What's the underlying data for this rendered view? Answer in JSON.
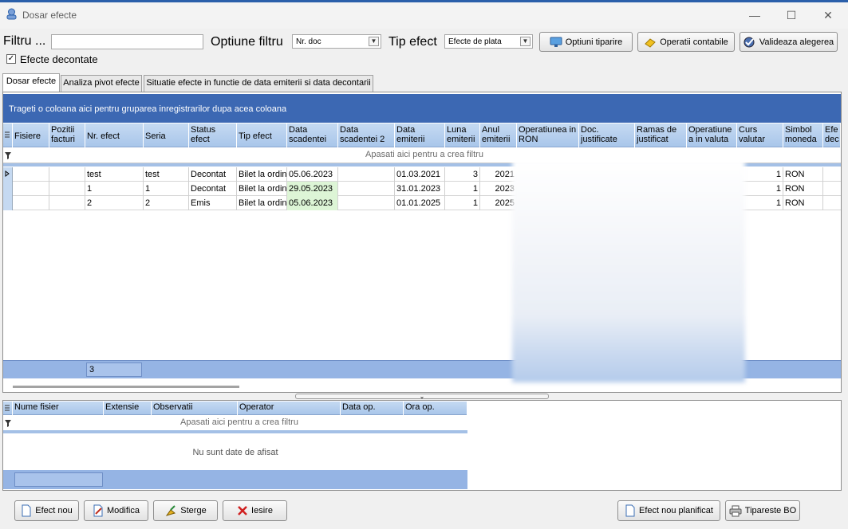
{
  "window": {
    "title": "Dosar efecte",
    "minimize": "—",
    "maximize": "☐",
    "close": "✕"
  },
  "toolbar": {
    "filter_label": "Filtru ...",
    "filter_value": "",
    "filter_option_label": "Optiune filtru",
    "filter_option_value": "Nr. doc",
    "effect_type_label": "Tip efect",
    "effect_type_value": "Efecte de plata",
    "print_options": "Optiuni tiparire",
    "accounting_ops": "Operatii contabile",
    "validate": "Valideaza alegerea",
    "settled_label": "Efecte decontate",
    "settled_checked": true
  },
  "tabs": [
    {
      "label": "Dosar efecte",
      "active": true
    },
    {
      "label": "Analiza pivot efecte",
      "active": false
    },
    {
      "label": "Situatie efecte in functie de data emiterii si data decontarii",
      "active": false
    }
  ],
  "grid": {
    "group_hint": "Trageti o coloana aici pentru gruparea inregistrarilor dupa acea coloana",
    "filter_hint": "Apasati aici pentru a  crea filtru",
    "columns": [
      "Fisiere",
      "Pozitii facturi",
      "Nr. efect",
      "Seria",
      "Status efect",
      "Tip efect",
      "Data scadentei",
      "Data scadentei 2",
      "Data emiterii",
      "Luna emiterii",
      "Anul emiterii",
      "Operatiunea in RON",
      "Doc. justificate",
      "Ramas de justificat",
      "Operatiune a in valuta",
      "Curs valutar",
      "Simbol moneda",
      "Efe dec"
    ],
    "rows": [
      {
        "fisiere": "",
        "pozitii": "",
        "nr": "test",
        "seria": "test",
        "status": "Decontat",
        "tip": "Bilet la ordin",
        "scadenta": "05.06.2023",
        "scadenta2": "",
        "emitere": "01.03.2021",
        "luna": "3",
        "an": "2021",
        "curs": "1",
        "moneda": "RON"
      },
      {
        "fisiere": "",
        "pozitii": "",
        "nr": "1",
        "seria": "1",
        "status": "Decontat",
        "tip": "Bilet la ordin",
        "scadenta": "29.05.2023",
        "scadenta2": "",
        "emitere": "31.01.2023",
        "luna": "1",
        "an": "2023",
        "curs": "1",
        "moneda": "RON"
      },
      {
        "fisiere": "",
        "pozitii": "",
        "nr": "2",
        "seria": "2",
        "status": "Emis",
        "tip": "Bilet la ordin",
        "scadenta": "05.06.2023",
        "scadenta2": "",
        "emitere": "01.01.2025",
        "luna": "1",
        "an": "2025",
        "curs": "1",
        "moneda": "RON"
      }
    ],
    "count": "3"
  },
  "files_grid": {
    "columns": [
      "Nume fisier",
      "Extensie",
      "Observatii",
      "Operator",
      "Data op.",
      "Ora op."
    ],
    "filter_hint": "Apasati aici pentru a  crea filtru",
    "empty_text": "Nu sunt date de afisat"
  },
  "buttons": {
    "new": "Efect nou",
    "modify": "Modifica",
    "delete": "Sterge",
    "exit": "Iesire",
    "new_planned": "Efect nou planificat",
    "print_bo": "Tipareste BO"
  },
  "colors": {
    "accent_blue": "#3c68b3",
    "header_blue": "#a9c6ea",
    "green_cell": "#ddf5d6"
  }
}
